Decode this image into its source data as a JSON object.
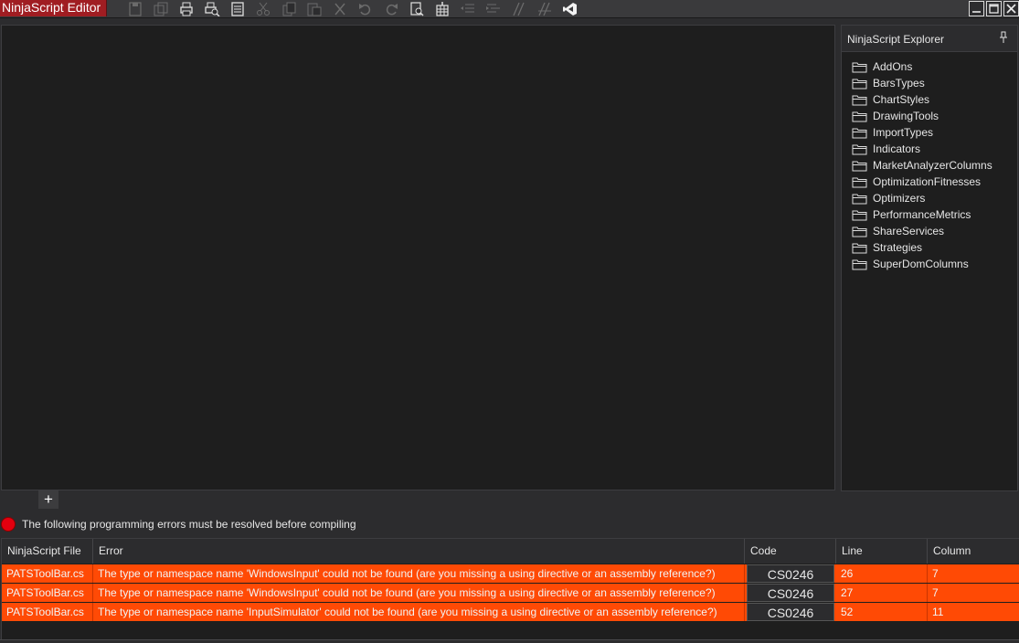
{
  "window": {
    "title": "NinjaScript Editor"
  },
  "toolbar": {
    "icons": [
      "save-icon",
      "save-all-icon",
      "print-icon",
      "print-preview-icon",
      "properties-icon",
      "cut-icon",
      "copy-icon",
      "paste-icon",
      "delete-icon",
      "undo-icon",
      "redo-icon",
      "find-icon",
      "compile-icon",
      "outdent-icon",
      "indent-icon",
      "comment-icon",
      "uncomment-icon",
      "visual-studio-icon"
    ]
  },
  "explorer": {
    "title": "NinjaScript Explorer",
    "folders": [
      "AddOns",
      "BarsTypes",
      "ChartStyles",
      "DrawingTools",
      "ImportTypes",
      "Indicators",
      "MarketAnalyzerColumns",
      "OptimizationFitnesses",
      "Optimizers",
      "PerformanceMetrics",
      "ShareServices",
      "Strategies",
      "SuperDomColumns"
    ]
  },
  "editor": {
    "add_tab_label": "+"
  },
  "errors": {
    "notice": "The following programming errors must be resolved before compiling",
    "columns": {
      "file": "NinjaScript File",
      "error": "Error",
      "code": "Code",
      "line": "Line",
      "column": "Column"
    },
    "rows": [
      {
        "file": "PATSToolBar.cs",
        "error": "The type or namespace name 'WindowsInput' could not be found (are you missing a using directive or an assembly reference?)",
        "code": "CS0246",
        "line": "26",
        "column": "7"
      },
      {
        "file": "PATSToolBar.cs",
        "error": "The type or namespace name 'WindowsInput' could not be found (are you missing a using directive or an assembly reference?)",
        "code": "CS0246",
        "line": "27",
        "column": "7"
      },
      {
        "file": "PATSToolBar.cs",
        "error": "The type or namespace name 'InputSimulator' could not be found (are you missing a using directive or an assembly reference?)",
        "code": "CS0246",
        "line": "52",
        "column": "11"
      }
    ]
  },
  "colors": {
    "error_row": "#ff4a05",
    "title_bg": "#a01d22",
    "error_dot": "#e3000f"
  }
}
